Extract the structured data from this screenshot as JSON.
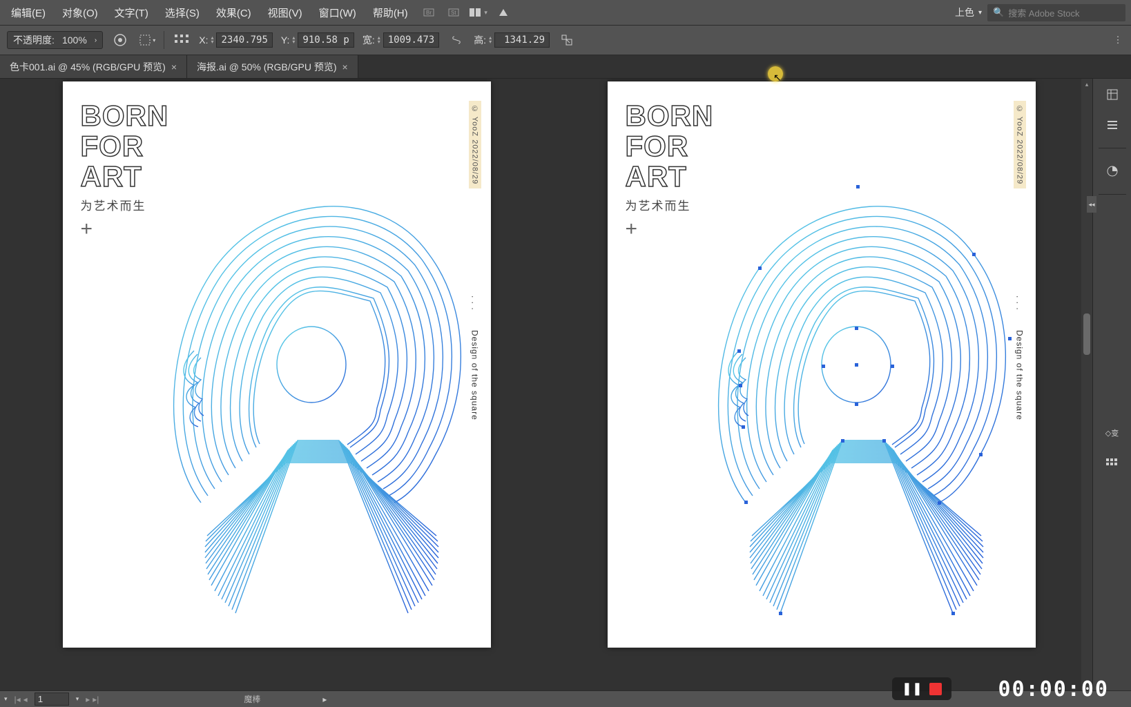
{
  "menu": {
    "edit": "编辑(E)",
    "object": "对象(O)",
    "text": "文字(T)",
    "select": "选择(S)",
    "effect": "效果(C)",
    "view": "视图(V)",
    "window": "窗口(W)",
    "help": "帮助(H)",
    "workspace": "上色",
    "search_placeholder": "搜索 Adobe Stock"
  },
  "options": {
    "opacity_label": "不透明度:",
    "opacity_value": "100%",
    "x_label": "X:",
    "x_value": "2340.795",
    "y_label": "Y:",
    "y_value": "910.58 p",
    "w_label": "宽:",
    "w_value": "1009.473",
    "h_label": "高:",
    "h_value": "1341.29 "
  },
  "tabs": [
    {
      "label": "色卡001.ai @ 45% (RGB/GPU 预览)"
    },
    {
      "label": "海报.ai @ 50% (RGB/GPU 预览)"
    }
  ],
  "artwork": {
    "title_line1": "BORN",
    "title_line2": "FOR",
    "title_line3": "ART",
    "subtitle": "为艺术而生",
    "plus": "+",
    "side_badge": "© YooZ   2022/08/29",
    "side_dots": ". . .",
    "side_text": "Design of the square"
  },
  "status": {
    "artboard_num": "1",
    "tool_hint": "魔棒"
  },
  "recorder": {
    "timer": "00:00:00"
  },
  "panels": {
    "transform_short": "变"
  }
}
